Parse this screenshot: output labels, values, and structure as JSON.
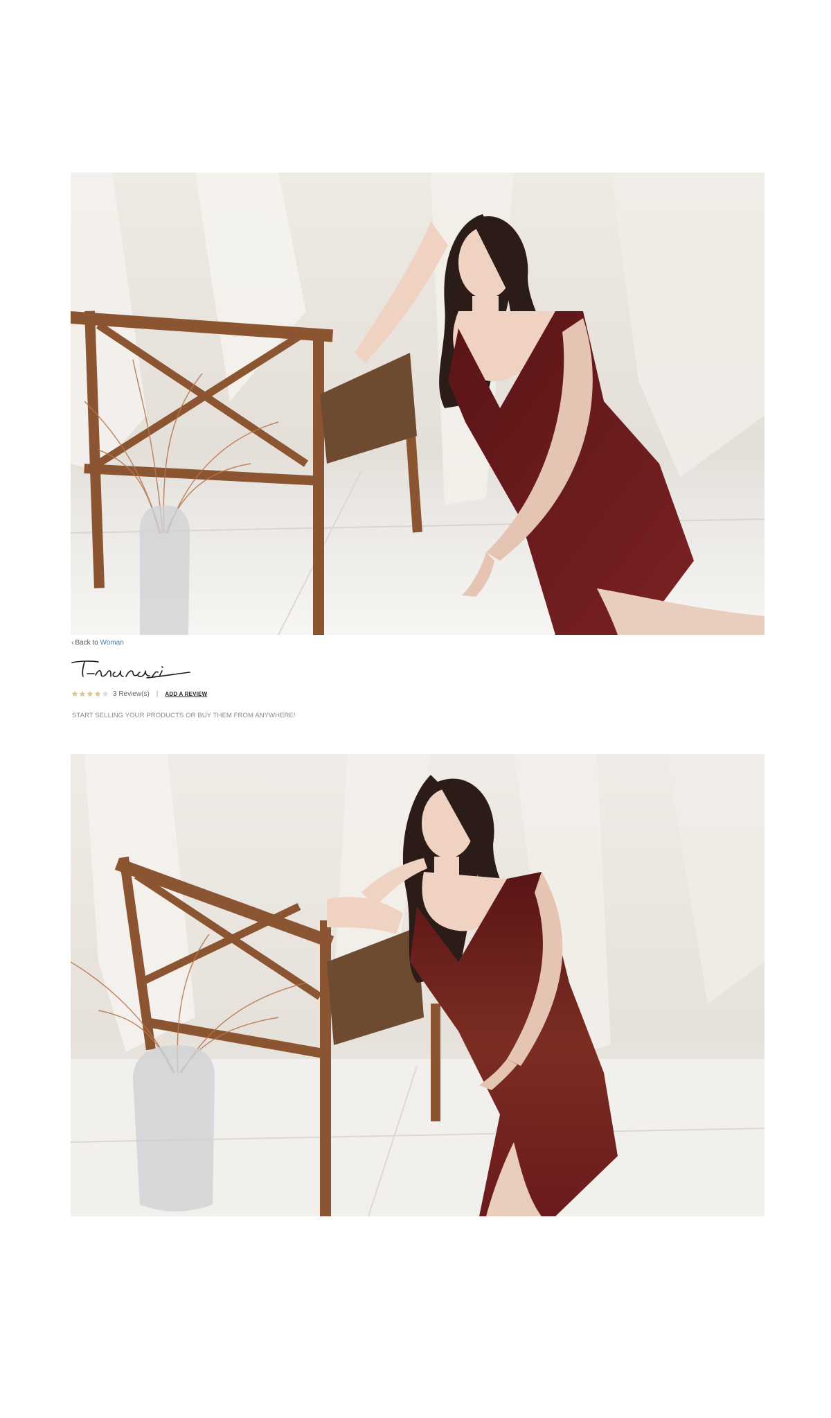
{
  "product": {
    "back_prefix": "Back to",
    "back_category": "Woman",
    "brand_logo_alt": "T-nani",
    "rating_stars": 4,
    "rating_max": 5,
    "reviews_label": "3 Review(s)",
    "separator": "|",
    "add_review_label": "ADD A REVIEW",
    "tagline": "START SELLING YOUR PRODUCTS OR BUY THEM FROM ANYWHERE!"
  },
  "colors": {
    "link": "#4a7fa8",
    "star_filled": "#d9c79a",
    "star_empty": "#dcdcdc",
    "dress": "#6b1a1c"
  },
  "icons": {
    "back": "chevron-left-icon",
    "star": "star-icon"
  }
}
